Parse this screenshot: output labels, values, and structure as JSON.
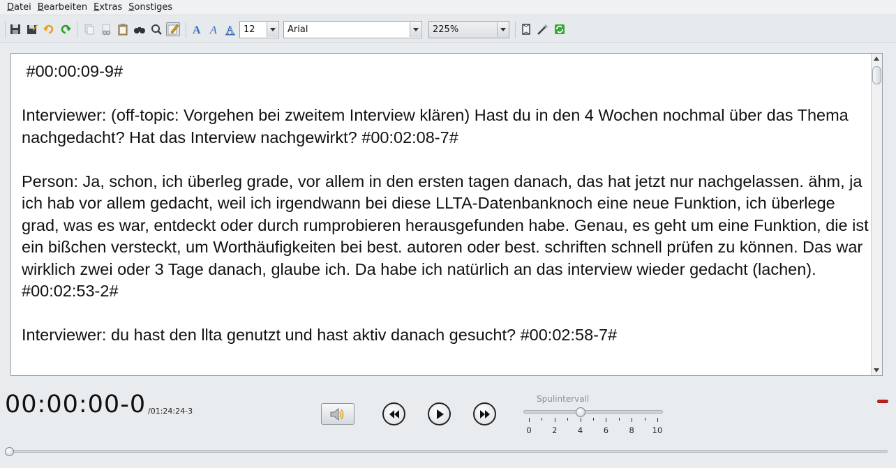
{
  "menubar": {
    "items": [
      {
        "mnemonic": "D",
        "rest": "atei"
      },
      {
        "mnemonic": "B",
        "rest": "earbeiten"
      },
      {
        "mnemonic": "E",
        "rest": "xtras"
      },
      {
        "mnemonic": "S",
        "rest": "onstiges"
      }
    ]
  },
  "toolbar": {
    "font_size": "12",
    "font_family": "Arial",
    "zoom": "225%"
  },
  "editor": {
    "text": " #00:00:09-9#\n\nInterviewer: (off-topic: Vorgehen bei zweitem Interview klären) Hast du in den 4 Wochen nochmal über das Thema nachgedacht? Hat das Interview nachgewirkt? #00:02:08-7#\n\nPerson: Ja, schon, ich überleg grade, vor allem in den ersten tagen danach, das hat jetzt nur nachgelassen. ähm, ja ich hab vor allem gedacht, weil ich irgendwann bei diese LLTA-Datenbanknoch eine neue Funktion, ich überlege grad, was es war, entdeckt oder durch rumprobieren herausgefunden habe. Genau, es geht um eine Funktion, die ist ein bißchen versteckt, um Worthäufigkeiten bei best. autoren oder best. schriften schnell prüfen zu können. Das war wirklich zwei oder 3 Tage danach, glaube ich. Da habe ich natürlich an das interview wieder gedacht (lachen).  #00:02:53-2#\n\nInterviewer: du hast den llta genutzt und hast aktiv danach gesucht? #00:02:58-7#"
  },
  "player": {
    "current_time": "00:00:00-0",
    "total_time": "/01:24:24-3",
    "position_fraction": 0.0
  },
  "spulintervall": {
    "label": "Spulintervall",
    "ticks": [
      "0",
      "2",
      "4",
      "6",
      "8",
      "10"
    ],
    "min": 0,
    "max": 10,
    "value": 4
  },
  "colors": {
    "marker": "#d21e1e",
    "redo": "#2a9d2a",
    "undo": "#e6a11a"
  }
}
